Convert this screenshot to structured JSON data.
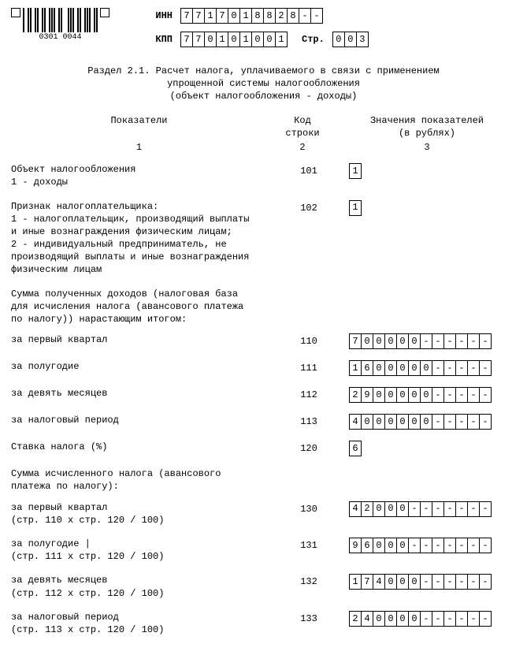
{
  "header": {
    "barcode_numbers": [
      "0301",
      "0044"
    ],
    "inn_label": "ИНН",
    "kpp_label": "КПП",
    "page_label": "Стр.",
    "inn": [
      "7",
      "7",
      "1",
      "7",
      "0",
      "1",
      "8",
      "8",
      "2",
      "8",
      "-",
      "-"
    ],
    "kpp": [
      "7",
      "7",
      "0",
      "1",
      "0",
      "1",
      "0",
      "0",
      "1"
    ],
    "page": [
      "0",
      "0",
      "3"
    ]
  },
  "title": "Раздел 2.1. Расчет налога, уплачиваемого в связи с применением\nупрощенной системы налогообложения\n(объект налогообложения - доходы)",
  "columns": {
    "c1": "Показатели",
    "c2": "Код\nстроки",
    "c3": "Значения показателей\n(в рублях)",
    "n1": "1",
    "n2": "2",
    "n3": "3"
  },
  "rows": [
    {
      "desc": "Объект налогообложения\n1 - доходы",
      "code": "101",
      "cells": [
        "1"
      ]
    },
    {
      "desc": "Признак налогоплательщика:\n1 - налогоплательщик, производящий выплаты\nи иные вознаграждения физическим лицам;\n2 - индивидуальный предприниматель, не\nпроизводящий выплаты и иные вознаграждения\nфизическим лицам",
      "code": "102",
      "cells": [
        "1"
      ]
    }
  ],
  "group1_heading": "Сумма полученных доходов (налоговая база\nдля исчисления налога (авансового платежа\nпо налогу)) нарастающим итогом:",
  "group1": [
    {
      "desc": "за первый квартал",
      "code": "110",
      "cells": [
        "7",
        "0",
        "0",
        "0",
        "0",
        "0",
        "-",
        "-",
        "-",
        "-",
        "-",
        "-"
      ]
    },
    {
      "desc": "за полугодие",
      "code": "111",
      "cells": [
        "1",
        "6",
        "0",
        "0",
        "0",
        "0",
        "0",
        "-",
        "-",
        "-",
        "-",
        "-"
      ]
    },
    {
      "desc": "за девять месяцев",
      "code": "112",
      "cells": [
        "2",
        "9",
        "0",
        "0",
        "0",
        "0",
        "0",
        "-",
        "-",
        "-",
        "-",
        "-"
      ]
    },
    {
      "desc": "за налоговый период",
      "code": "113",
      "cells": [
        "4",
        "0",
        "0",
        "0",
        "0",
        "0",
        "0",
        "-",
        "-",
        "-",
        "-",
        "-"
      ]
    }
  ],
  "rate_row": {
    "desc": "Ставка налога (%)",
    "code": "120",
    "cells": [
      "6"
    ]
  },
  "group2_heading": "Сумма исчисленного налога (авансового\nплатежа по налогу):",
  "group2": [
    {
      "desc": "за первый квартал\n(стр. 110 х стр. 120 / 100)",
      "code": "130",
      "cells": [
        "4",
        "2",
        "0",
        "0",
        "0",
        "-",
        "-",
        "-",
        "-",
        "-",
        "-",
        "-"
      ]
    },
    {
      "desc": "за полугодие            |\n(стр. 111 х стр. 120 / 100)",
      "code": "131",
      "cells": [
        "9",
        "6",
        "0",
        "0",
        "0",
        "-",
        "-",
        "-",
        "-",
        "-",
        "-",
        "-"
      ]
    },
    {
      "desc": "за девять месяцев\n(стр. 112 х стр. 120 / 100)",
      "code": "132",
      "cells": [
        "1",
        "7",
        "4",
        "0",
        "0",
        "0",
        "-",
        "-",
        "-",
        "-",
        "-",
        "-"
      ]
    },
    {
      "desc": "за налоговый период\n(стр. 113 х стр. 120 / 100)",
      "code": "133",
      "cells": [
        "2",
        "4",
        "0",
        "0",
        "0",
        "0",
        "-",
        "-",
        "-",
        "-",
        "-",
        "-"
      ]
    }
  ]
}
